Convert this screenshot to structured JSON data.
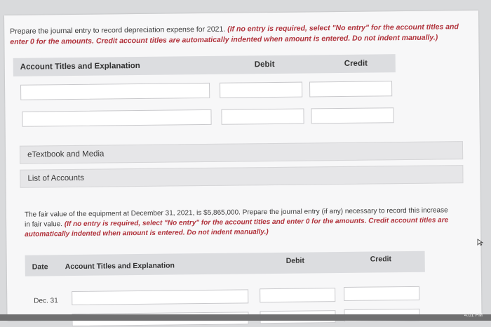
{
  "question1": {
    "text": "Prepare the journal entry to record depreciation expense for 2021. ",
    "note": "(If no entry is required, select \"No entry\" for the account titles and enter 0 for the amounts. Credit account titles are automatically indented when amount is entered. Do not indent manually.)"
  },
  "table1": {
    "col_account": "Account Titles and Explanation",
    "col_debit": "Debit",
    "col_credit": "Credit"
  },
  "links": {
    "etextbook": "eTextbook and Media",
    "list_accounts": "List of Accounts"
  },
  "question2": {
    "text": "The fair value of the equipment at December 31, 2021, is $5,865,000. Prepare the journal entry (if any) necessary to record this increase in fair value. ",
    "note": "(If no entry is required, select \"No entry\" for the account titles and enter 0 for the amounts. Credit account titles are automatically indented when amount is entered. Do not indent manually.)"
  },
  "table2": {
    "col_date": "Date",
    "col_account": "Account Titles and Explanation",
    "col_debit": "Debit",
    "col_credit": "Credit",
    "row1_date": "Dec. 31"
  },
  "system": {
    "clock": "4:01 PM"
  }
}
